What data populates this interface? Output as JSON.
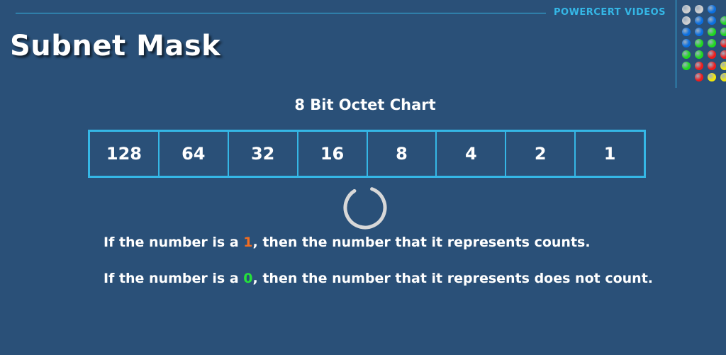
{
  "header": {
    "brand": "POWERCERT VIDEOS",
    "title": "Subnet Mask"
  },
  "chart": {
    "title": "8 Bit Octet Chart",
    "cells": [
      "128",
      "64",
      "32",
      "16",
      "8",
      "4",
      "2",
      "1"
    ]
  },
  "rules": [
    {
      "prefix": "If the number is a ",
      "digit": "1",
      "suffix": ", then the number that it represents counts."
    },
    {
      "prefix": "If the number is a ",
      "digit": "0",
      "suffix": ", then the number that it represents does not count."
    }
  ],
  "colors": {
    "background": "#2a5078",
    "accent": "#35b7e6",
    "digit_one": "#f26d21",
    "digit_zero": "#25e23a"
  },
  "decor": {
    "dot_rows": [
      [
        "#d0d0d0",
        "#d0d0d0",
        "#0a6fe0"
      ],
      [
        "#d0d0d0",
        "#0a6fe0",
        "#0a6fe0",
        "#1fd81f"
      ],
      [
        "#0a6fe0",
        "#0a6fe0",
        "#1fd81f",
        "#1fd81f"
      ],
      [
        "#0a6fe0",
        "#1fd81f",
        "#1fd81f",
        "#ee1c1c"
      ],
      [
        "#1fd81f",
        "#1fd81f",
        "#ee1c1c",
        "#ee1c1c"
      ],
      [
        "#1fd81f",
        "#ee1c1c",
        "#ee1c1c",
        "#f3e80c"
      ],
      [
        "#ee1c1c",
        "#f3e80c",
        "#f3e80c"
      ]
    ]
  }
}
